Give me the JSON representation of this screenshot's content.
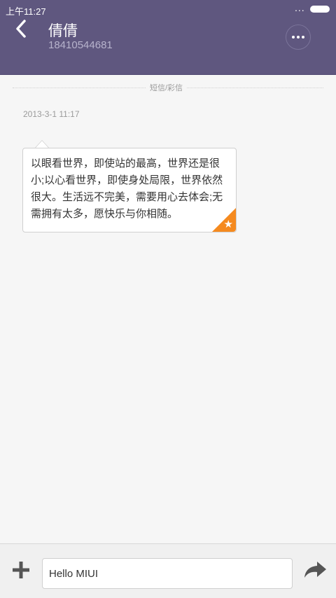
{
  "status": {
    "time": "上午11:27",
    "dots": "..."
  },
  "header": {
    "contact_name": "倩倩",
    "phone": "18410544681"
  },
  "divider": {
    "label": "短信/彩信"
  },
  "messages": [
    {
      "timestamp": "2013-3-1 11:17",
      "text": "以眼看世界，即使站的最高，世界还是很小;以心看世界，即使身处局限，世界依然很大。生活远不完美，需要用心去体会;无需拥有太多，愿快乐与你相随。",
      "starred": true
    }
  ],
  "composer": {
    "text": "Hello MIUI"
  },
  "colors": {
    "header_bg": "#5f577f",
    "star_accent": "#f58a1f"
  }
}
